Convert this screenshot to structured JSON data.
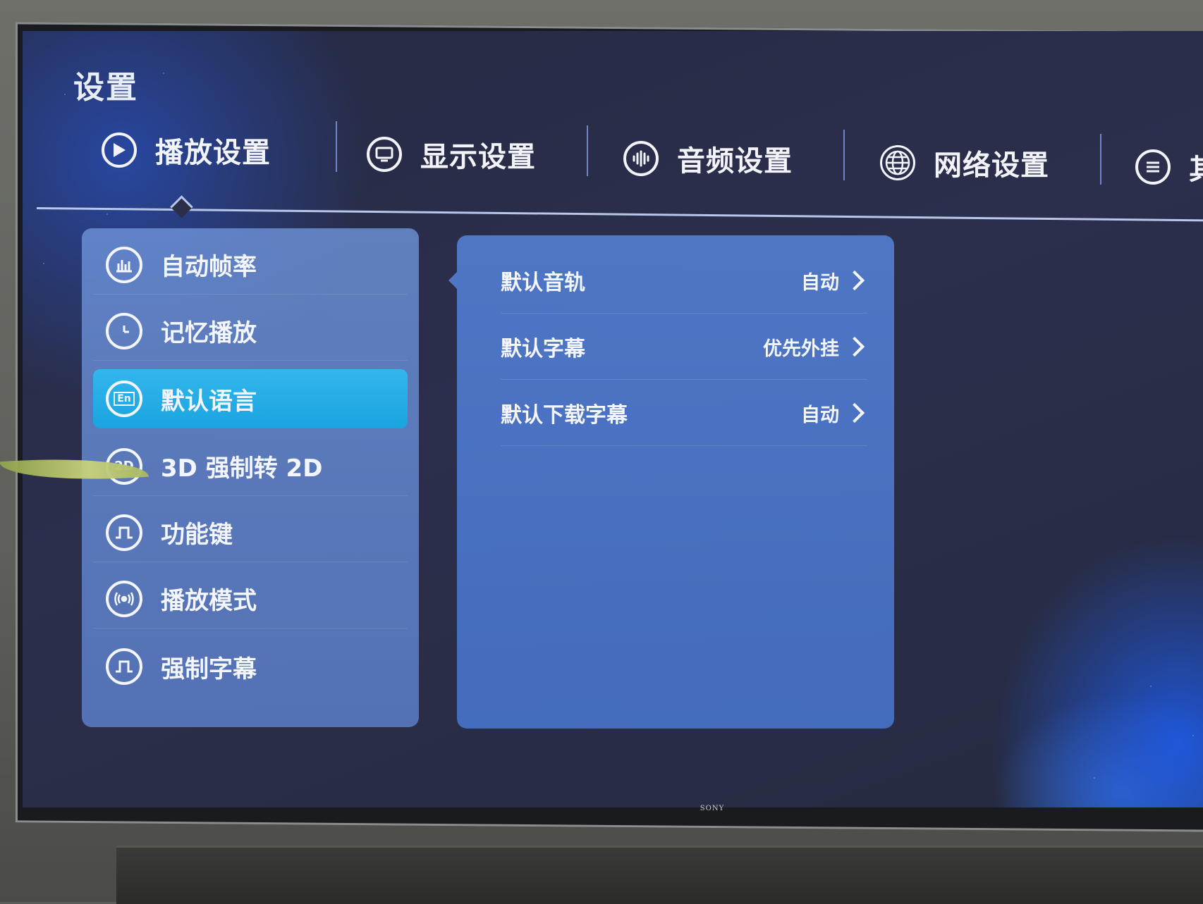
{
  "header": {
    "title": "设置"
  },
  "tabs": [
    {
      "label": "播放设置",
      "icon": "play-icon"
    },
    {
      "label": "显示设置",
      "icon": "display-icon"
    },
    {
      "label": "音频设置",
      "icon": "audio-icon"
    },
    {
      "label": "网络设置",
      "icon": "globe-icon"
    },
    {
      "label": "其",
      "icon": "menu-icon"
    }
  ],
  "menu": {
    "items": [
      {
        "label": "自动帧率",
        "icon": "frame-rate-icon"
      },
      {
        "label": "记忆播放",
        "icon": "clock-icon"
      },
      {
        "label": "默认语言",
        "icon": "language-icon",
        "icon_text": "En"
      },
      {
        "label": "3D 强制转 2D",
        "icon": "2d-icon",
        "icon_text": "2D"
      },
      {
        "label": "功能键",
        "icon": "function-key-icon"
      },
      {
        "label": "播放模式",
        "icon": "broadcast-icon"
      },
      {
        "label": "强制字幕",
        "icon": "subtitle-icon"
      }
    ],
    "active_index": 2
  },
  "options": [
    {
      "label": "默认音轨",
      "value": "自动"
    },
    {
      "label": "默认字幕",
      "value": "优先外挂"
    },
    {
      "label": "默认下载字幕",
      "value": "自动"
    }
  ],
  "device": {
    "brand": "SONY"
  },
  "colors": {
    "active_item": "#1aa4e0",
    "panel": "#5480d6",
    "screen_bg": "#2a2e49"
  }
}
